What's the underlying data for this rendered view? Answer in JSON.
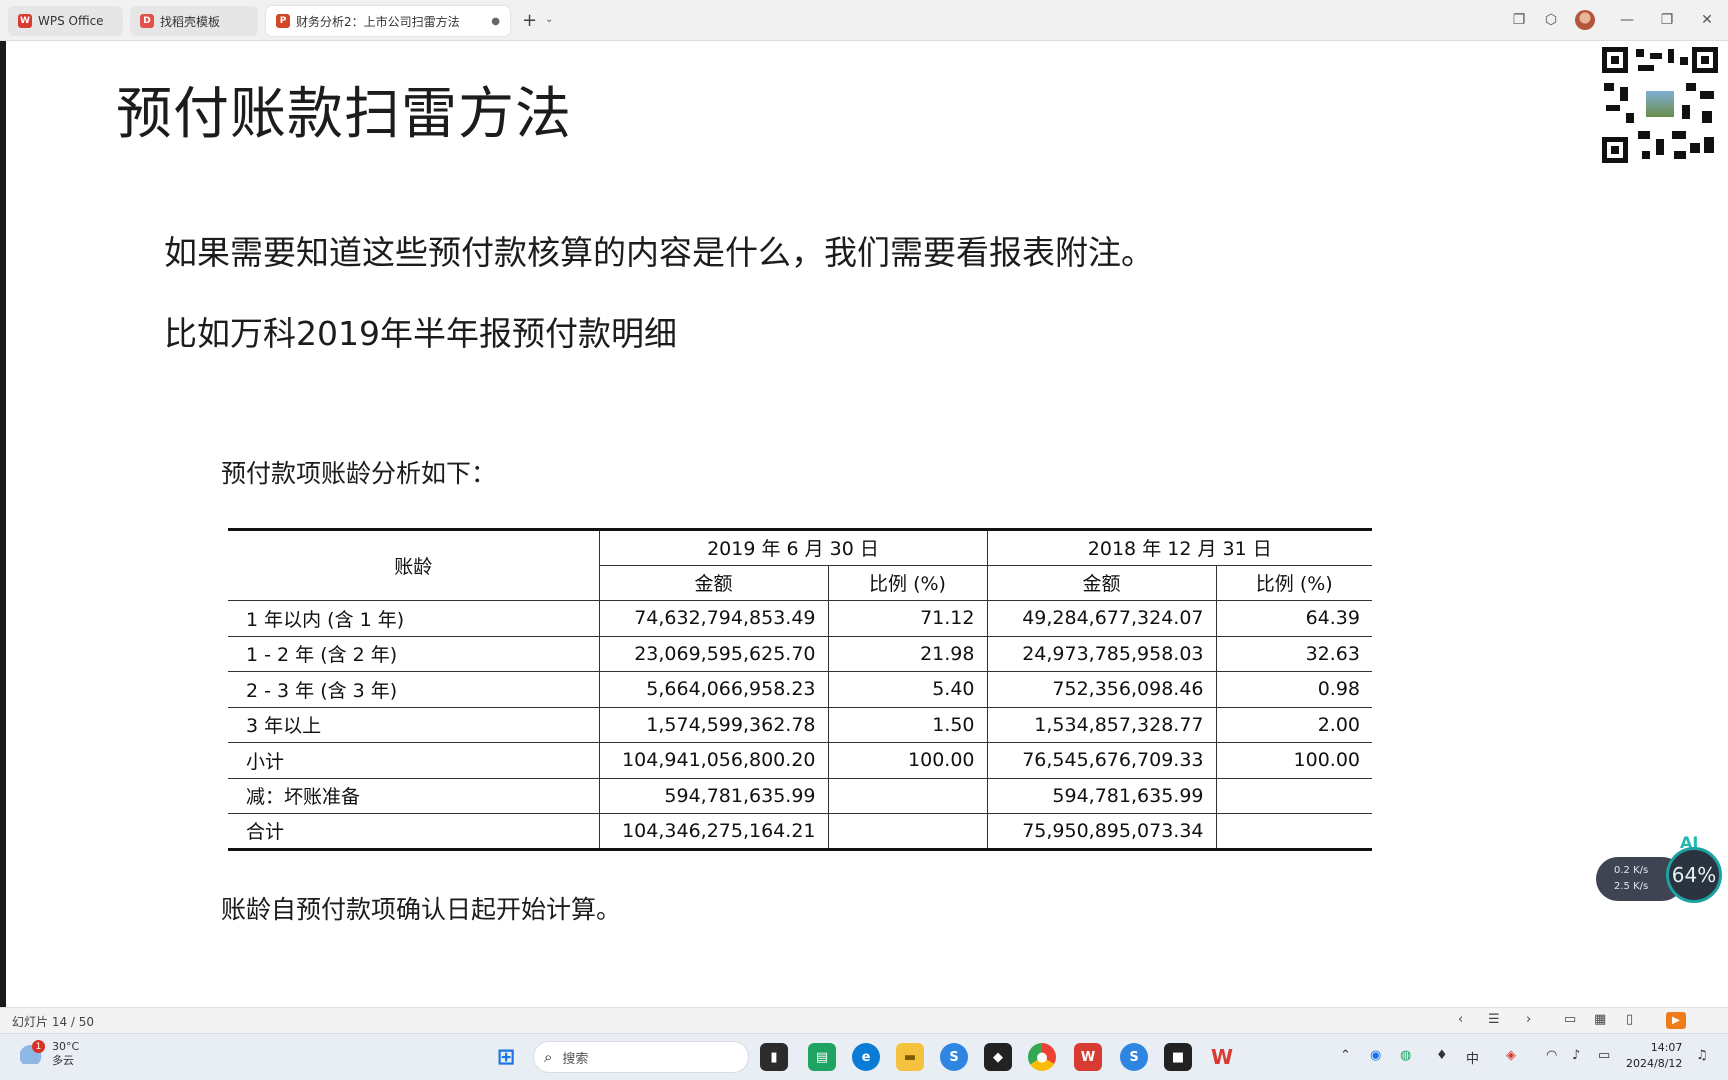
{
  "tabs": [
    {
      "label": "WPS Office"
    },
    {
      "label": "找稻壳模板"
    },
    {
      "label": "财务分析2：上市公司扫雷方法"
    }
  ],
  "slide": {
    "title": "预付账款扫雷方法",
    "paragraph1": "如果需要知道这些预付款核算的内容是什么，我们需要看报表附注。",
    "paragraph2": "比如万科2019年半年报预付款明细",
    "table_caption": "预付款项账龄分析如下：",
    "footnote": "账龄自预付款项确认日起开始计算。",
    "table": {
      "corner": "账龄",
      "period1": "2019 年 6 月 30 日",
      "period2": "2018 年 12 月 31 日",
      "col_amount": "金额",
      "col_ratio": "比例 (%)",
      "rows": [
        {
          "label": "1 年以内 (含 1 年)",
          "a1": "74,632,794,853.49",
          "r1": "71.12",
          "a2": "49,284,677,324.07",
          "r2": "64.39"
        },
        {
          "label": "1 - 2 年 (含 2 年)",
          "a1": "23,069,595,625.70",
          "r1": "21.98",
          "a2": "24,973,785,958.03",
          "r2": "32.63"
        },
        {
          "label": "2 - 3 年 (含 3 年)",
          "a1": "5,664,066,958.23",
          "r1": "5.40",
          "a2": "752,356,098.46",
          "r2": "0.98"
        },
        {
          "label": "3 年以上",
          "a1": "1,574,599,362.78",
          "r1": "1.50",
          "a2": "1,534,857,328.77",
          "r2": "2.00"
        },
        {
          "label": "小计",
          "a1": "104,941,056,800.20",
          "r1": "100.00",
          "a2": "76,545,676,709.33",
          "r2": "100.00"
        },
        {
          "label": "减：坏账准备",
          "a1": "594,781,635.99",
          "r1": "",
          "a2": "594,781,635.99",
          "r2": ""
        },
        {
          "label": "合计",
          "a1": "104,346,275,164.21",
          "r1": "",
          "a2": "75,950,895,073.34",
          "r2": ""
        }
      ]
    }
  },
  "net_widget": {
    "ai_label": "AI",
    "up": "0.2 K/s",
    "down": "2.5 K/s",
    "percent": "64%"
  },
  "statusbar": {
    "slide_count": "幻灯片 14 / 50"
  },
  "taskbar": {
    "weather_temp": "30°C",
    "weather_desc": "多云",
    "weather_badge": "1",
    "search_placeholder": "搜索",
    "time": "14:07",
    "date": "2024/8/12",
    "ime": "中"
  },
  "colors": {
    "accent_wps": "#d83b32",
    "play_button": "#f07d1a"
  }
}
